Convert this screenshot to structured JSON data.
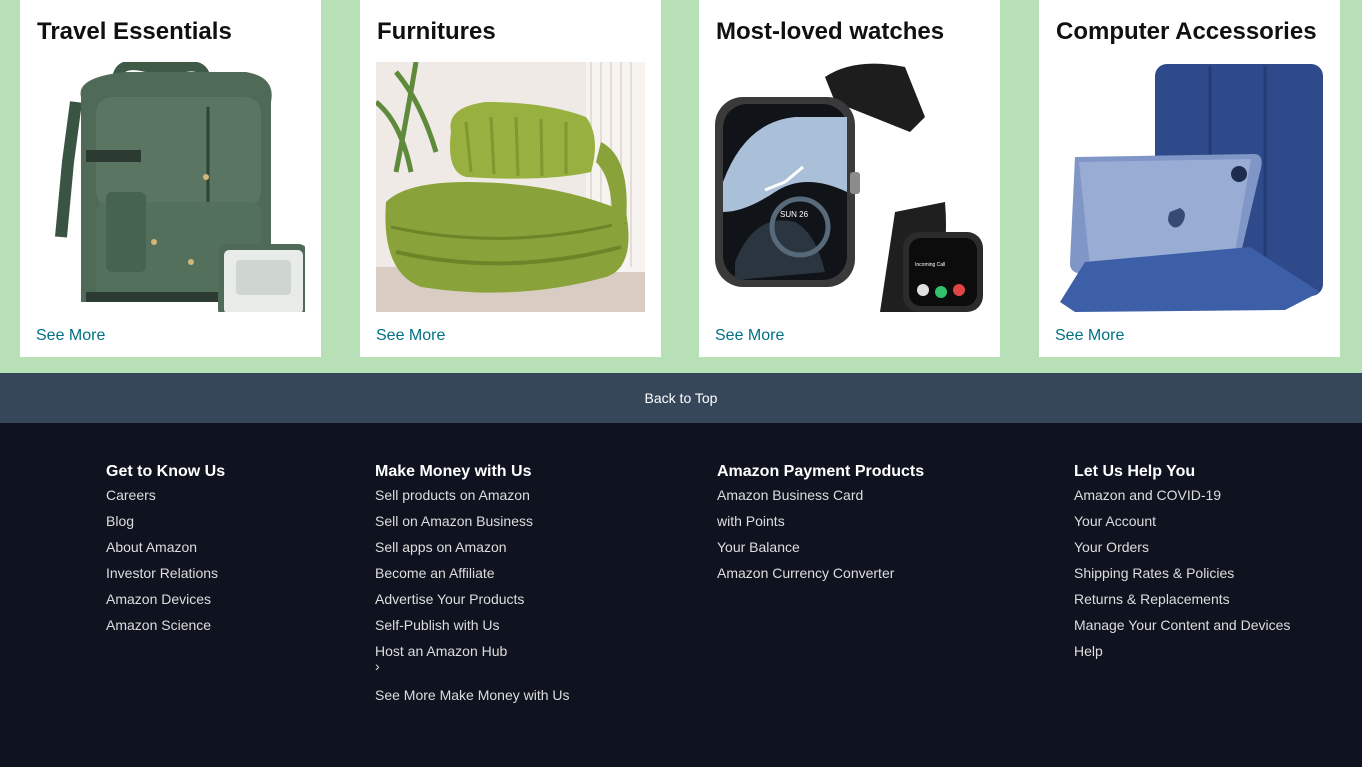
{
  "cards": [
    {
      "title": "Travel Essentials",
      "link": "See More",
      "image": "green-backpack"
    },
    {
      "title": "Furnitures",
      "link": "See More",
      "image": "green-corduroy-floor-chair"
    },
    {
      "title": "Most-loved watches",
      "link": "See More",
      "image": "black-smartwatch"
    },
    {
      "title": "Computer Accessories",
      "link": "See More",
      "image": "blue-tablet-case"
    }
  ],
  "back_to_top": "Back to Top",
  "footer": {
    "columns": [
      {
        "heading": "Get to Know Us",
        "links": [
          "Careers",
          "Blog",
          "About Amazon",
          "Investor Relations",
          "Amazon Devices",
          "Amazon Science"
        ]
      },
      {
        "heading": "Make Money with Us",
        "links": [
          "Sell products on Amazon",
          "Sell on Amazon Business",
          "Sell apps on Amazon",
          "Become an Affiliate",
          "Advertise Your Products",
          "Self-Publish with Us",
          "Host an Amazon Hub"
        ],
        "chevron": "›",
        "more": "See More Make Money with Us"
      },
      {
        "heading": "Amazon Payment Products",
        "links": [
          "Amazon Business Card",
          "with Points",
          "Your Balance",
          "Amazon Currency Converter"
        ]
      },
      {
        "heading": "Let Us Help You",
        "links": [
          "Amazon and COVID-19",
          "Your Account",
          "Your Orders",
          "Shipping Rates & Policies",
          "Returns & Replacements",
          "Manage Your Content and Devices",
          "Help"
        ]
      }
    ]
  },
  "colors": {
    "page_green": "#b7e0b7",
    "link_teal": "#007185",
    "back_to_top_bg": "#37475a",
    "footer_bg": "#0f1320"
  },
  "watch_screen": {
    "date": "SUN 26",
    "small_screen_label": "Incoming Call"
  }
}
